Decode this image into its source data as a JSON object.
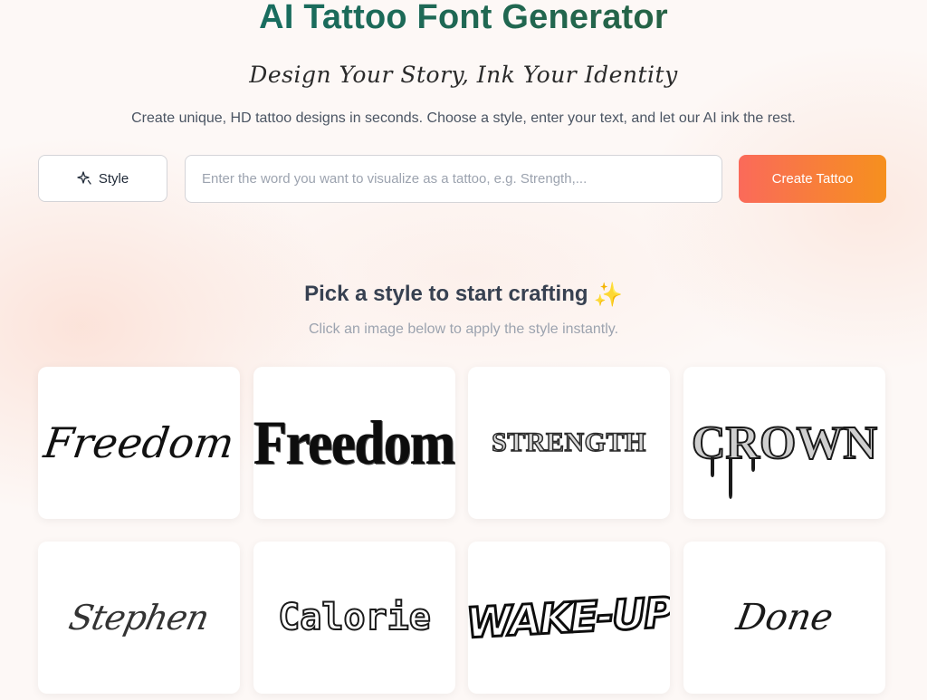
{
  "header": {
    "title": "AI Tattoo Font Generator",
    "tagline": "Design Your Story, Ink Your Identity",
    "subtitle": "Create unique, HD tattoo designs in seconds. Choose a style, enter your text, and let our AI ink the rest."
  },
  "form": {
    "style_button_label": "Style",
    "style_icon": "sparkle-outline-icon",
    "input_placeholder": "Enter the word you want to visualize as a tattoo, e.g. Strength,...",
    "input_value": "",
    "create_button_label": "Create Tattoo"
  },
  "styles_section": {
    "title": "Pick a style to start crafting",
    "title_icon": "sparkles-icon",
    "subtitle": "Click an image below to apply the style instantly.",
    "cards": [
      {
        "word": "Freedom"
      },
      {
        "word": "Freedom"
      },
      {
        "word": "STRENGTH"
      },
      {
        "word": "CROWN"
      },
      {
        "word": "Stephen"
      },
      {
        "word": "Calorie"
      },
      {
        "word": "WAKE-UP"
      },
      {
        "word": "Done"
      }
    ]
  },
  "colors": {
    "title_gradient_start": "#10736f",
    "title_gradient_end": "#2f5a2f",
    "create_button_start": "#fa6a5a",
    "create_button_end": "#f6901e"
  }
}
